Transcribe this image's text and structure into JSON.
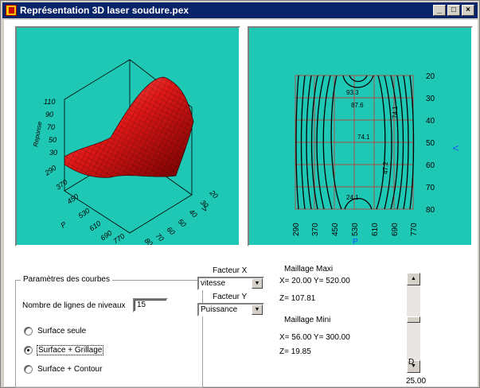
{
  "window": {
    "title": "Représentation 3D laser soudure.pex",
    "min_label": "_",
    "max_label": "□",
    "close_label": "×"
  },
  "surface": {
    "z_label": "Reponse",
    "z_ticks": [
      "110",
      "90",
      "70",
      "50",
      "30"
    ],
    "p_label": "P",
    "p_ticks": [
      "290",
      "370",
      "450",
      "530",
      "610",
      "690",
      "770"
    ],
    "v_label": "V",
    "v_ticks": [
      "20",
      "30",
      "40",
      "50",
      "60",
      "70",
      "80"
    ]
  },
  "contour": {
    "x_label": "P",
    "x_ticks": [
      "290",
      "370",
      "450",
      "530",
      "610",
      "690",
      "770"
    ],
    "y_label": "V",
    "y_ticks": [
      "20",
      "30",
      "40",
      "50",
      "60",
      "70",
      "80"
    ],
    "labels": [
      "93.3",
      "87.6",
      "74.1",
      "24.1",
      "47.2",
      "74.1"
    ]
  },
  "params": {
    "group_title": "Paramètres des courbes",
    "levels_label": "Nombre de lignes de niveaux",
    "levels_value": "15",
    "options": [
      {
        "label": "Surface seule",
        "selected": false
      },
      {
        "label": "Surface + Grillage",
        "selected": true
      },
      {
        "label": "Surface + Contour",
        "selected": false
      }
    ]
  },
  "factors": {
    "x_label": "Facteur X",
    "x_value": "vitesse",
    "y_label": "Facteur Y",
    "y_value": "Puissance"
  },
  "stats": {
    "max_title": "Maillage Maxi",
    "max_xy": "X= 20.00  Y= 520.00",
    "max_z": "Z= 107.81",
    "min_title": "Maillage Mini",
    "min_xy": "X= 56.00  Y= 300.00",
    "min_z": "Z= 19.85"
  },
  "slider": {
    "label": "D",
    "value": "25.00"
  },
  "colors": {
    "panel": "#1ec8b4",
    "titlebar": "#0a246a",
    "surface": "#e01818",
    "axis_label": "#2050ff"
  }
}
